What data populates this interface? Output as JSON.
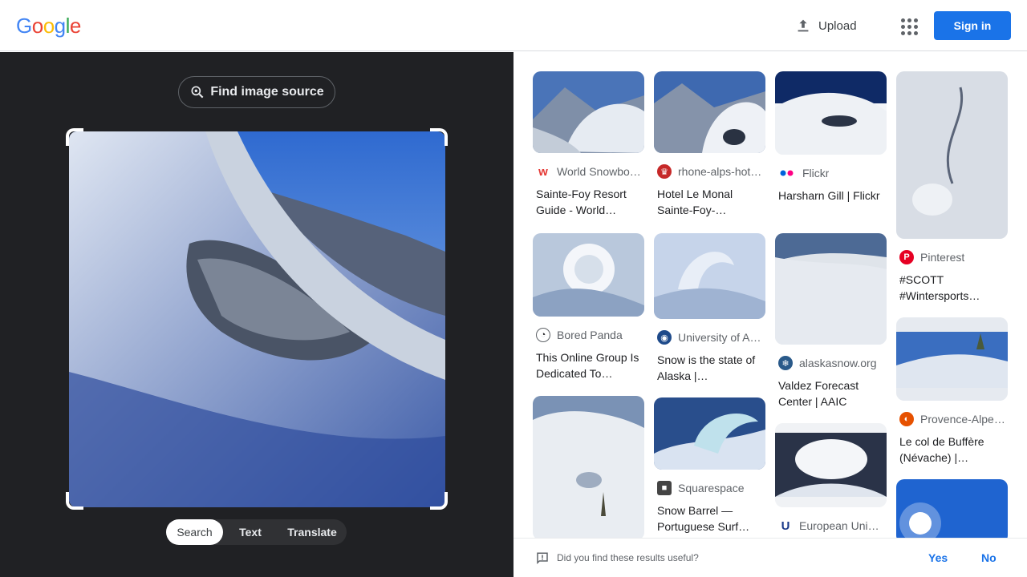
{
  "header": {
    "logo_letters": [
      "G",
      "o",
      "o",
      "g",
      "l",
      "e"
    ],
    "logo_colors": [
      "#4285f4",
      "#ea4335",
      "#fbbc05",
      "#4285f4",
      "#34a853",
      "#ea4335"
    ],
    "upload_label": "Upload",
    "apps_icon": "apps-grid-icon",
    "signin_label": "Sign in"
  },
  "left_pane": {
    "find_source_label": "Find image source",
    "modes": [
      {
        "label": "Search",
        "active": true
      },
      {
        "label": "Text",
        "active": false
      },
      {
        "label": "Translate",
        "active": false
      }
    ]
  },
  "results": [
    {
      "source": "World Snowbo…",
      "title": "Sainte-Foy Resort Guide - World…",
      "fav_color": "#e53935",
      "fav_glyph": "w"
    },
    {
      "source": "rhone-alps-hot…",
      "title": "Hotel Le Monal Sainte-Foy-…",
      "fav_color": "#c62828",
      "fav_glyph": "♛"
    },
    {
      "source": "Flickr",
      "title": "Harsharn Gill | Flickr",
      "fav_color": "#ffffff",
      "fav_glyph": ""
    },
    {
      "source": "Pinterest",
      "title": "#SCOTT #Wintersports…",
      "fav_color": "#e60023",
      "fav_glyph": "P"
    },
    {
      "source": "Bored Panda",
      "title": "This Online Group Is Dedicated To…",
      "fav_color": "#ffffff",
      "fav_glyph": "🐼"
    },
    {
      "source": "University of A…",
      "title": "Snow is the state of Alaska |…",
      "fav_color": "#1e4a8a",
      "fav_glyph": "◉"
    },
    {
      "source": "alaskasnow.org",
      "title": "Valdez Forecast Center | AAIC",
      "fav_color": "#2a5a8a",
      "fav_glyph": "❄"
    },
    {
      "source": "Provence-Alpe…",
      "title": "Le col de Buffère (Névache) |…",
      "fav_color": "#e65100",
      "fav_glyph": "◐"
    },
    {
      "source": "Squarespace",
      "title": "Snow Barrel — Portuguese Surf…",
      "fav_color": "#444444",
      "fav_glyph": "■"
    },
    {
      "source": "European Univ…",
      "title": "",
      "fav_color": "#ffffff",
      "fav_glyph": "U"
    }
  ],
  "feedback": {
    "question": "Did you find these results useful?",
    "yes_label": "Yes",
    "no_label": "No"
  }
}
